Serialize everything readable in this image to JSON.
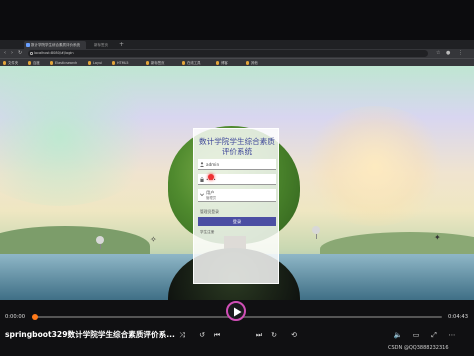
{
  "browser": {
    "active_tab_label": "数计学院学生综合素质评价系统",
    "other_tab_label": "新标签页",
    "new_tab_symbol": "+",
    "url": "localhost:8080/#/login",
    "bookmarks": [
      "文件夹",
      "百度",
      "Elasticsearch",
      "Layui",
      "HTML5",
      "新标签页",
      "在线工具",
      "博客",
      "其他"
    ]
  },
  "login": {
    "title": "数计学院学生综合素质评价系统",
    "username_value": "admin",
    "password_value": "••••",
    "role_value": "用户",
    "role_sub": "管理员",
    "role_label": "管理员登录",
    "login_button": "登录",
    "register_link": "学生注册"
  },
  "player": {
    "current_time": "0:00:00",
    "total_time": "0:04:43",
    "progress_fraction": 0.0,
    "video_title": "springboot329数计学院学生综合素质评价系...",
    "watermark": "CSDN @QQ3888232316",
    "accent": "#ff7a1a"
  }
}
